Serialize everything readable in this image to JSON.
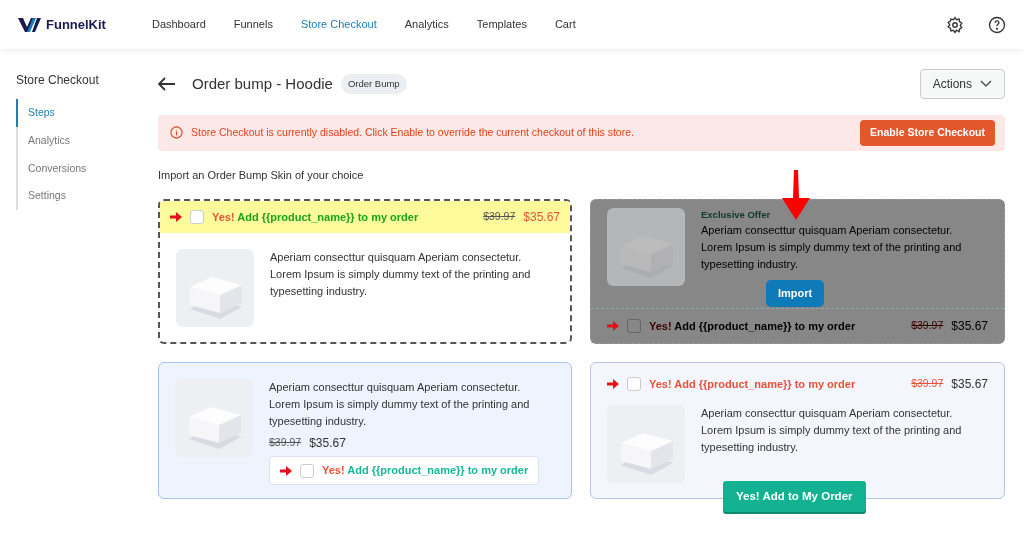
{
  "brand": {
    "name": "FunnelKit"
  },
  "nav": [
    {
      "label": "Dashboard",
      "selected": false
    },
    {
      "label": "Funnels",
      "selected": false
    },
    {
      "label": "Store Checkout",
      "selected": true
    },
    {
      "label": "Analytics",
      "selected": false
    },
    {
      "label": "Templates",
      "selected": false
    },
    {
      "label": "Cart",
      "selected": false
    }
  ],
  "sidebar": {
    "title": "Store Checkout",
    "items": [
      {
        "label": "Steps",
        "selected": true
      },
      {
        "label": "Analytics",
        "selected": false
      },
      {
        "label": "Conversions",
        "selected": false
      },
      {
        "label": "Settings",
        "selected": false
      }
    ]
  },
  "page": {
    "title": "Order bump - Hoodie",
    "badge": "Order Bump",
    "actions": "Actions"
  },
  "alert": {
    "message": "Store Checkout is currently disabled. Click Enable to override the current checkout of this store.",
    "button": "Enable Store Checkout"
  },
  "intro": "Import an Order Bump Skin of your choice",
  "skins": [
    {
      "kind": "header-bar",
      "yes": "Yes!",
      "headline": "Add {{product_name}} to my order",
      "old_price": "$39.97",
      "price": "$35.67",
      "checked": false,
      "description": "Aperiam consecttur quisquam Aperiam consectetur. Lorem Ipsum is simply dummy text of the printing and typesetting industry.",
      "hovered": false
    },
    {
      "kind": "offer",
      "label": "Exclusive Offer",
      "yes": "Yes!",
      "headline": "Add {{product_name}} to my order",
      "old_price": "$39.97",
      "price": "$35.67",
      "checked": false,
      "description": "Aperiam consecttur quisquam Aperiam consectetur. Lorem Ipsum is simply dummy text of the printing and typesetting industry.",
      "hovered": true,
      "import": "Import"
    },
    {
      "kind": "inline-box",
      "yes": "Yes!",
      "headline": "Add {{product_name}} to my order",
      "old_price": "$39.97",
      "price": "$35.67",
      "checked": false,
      "description": "Aperiam consecttur quisquam Aperiam consectetur. Lorem Ipsum is simply dummy text of the printing and typesetting industry.",
      "hovered": false
    },
    {
      "kind": "cta",
      "yes": "Yes!",
      "headline": "Add {{product_name}} to my order",
      "old_price": "$39.97",
      "price": "$35.67",
      "checked": false,
      "description": "Aperiam consecttur quisquam Aperiam consectetur. Lorem Ipsum is simply dummy text of the printing and typesetting industry.",
      "hovered": false,
      "button": "Yes! Add to My Order"
    }
  ]
}
